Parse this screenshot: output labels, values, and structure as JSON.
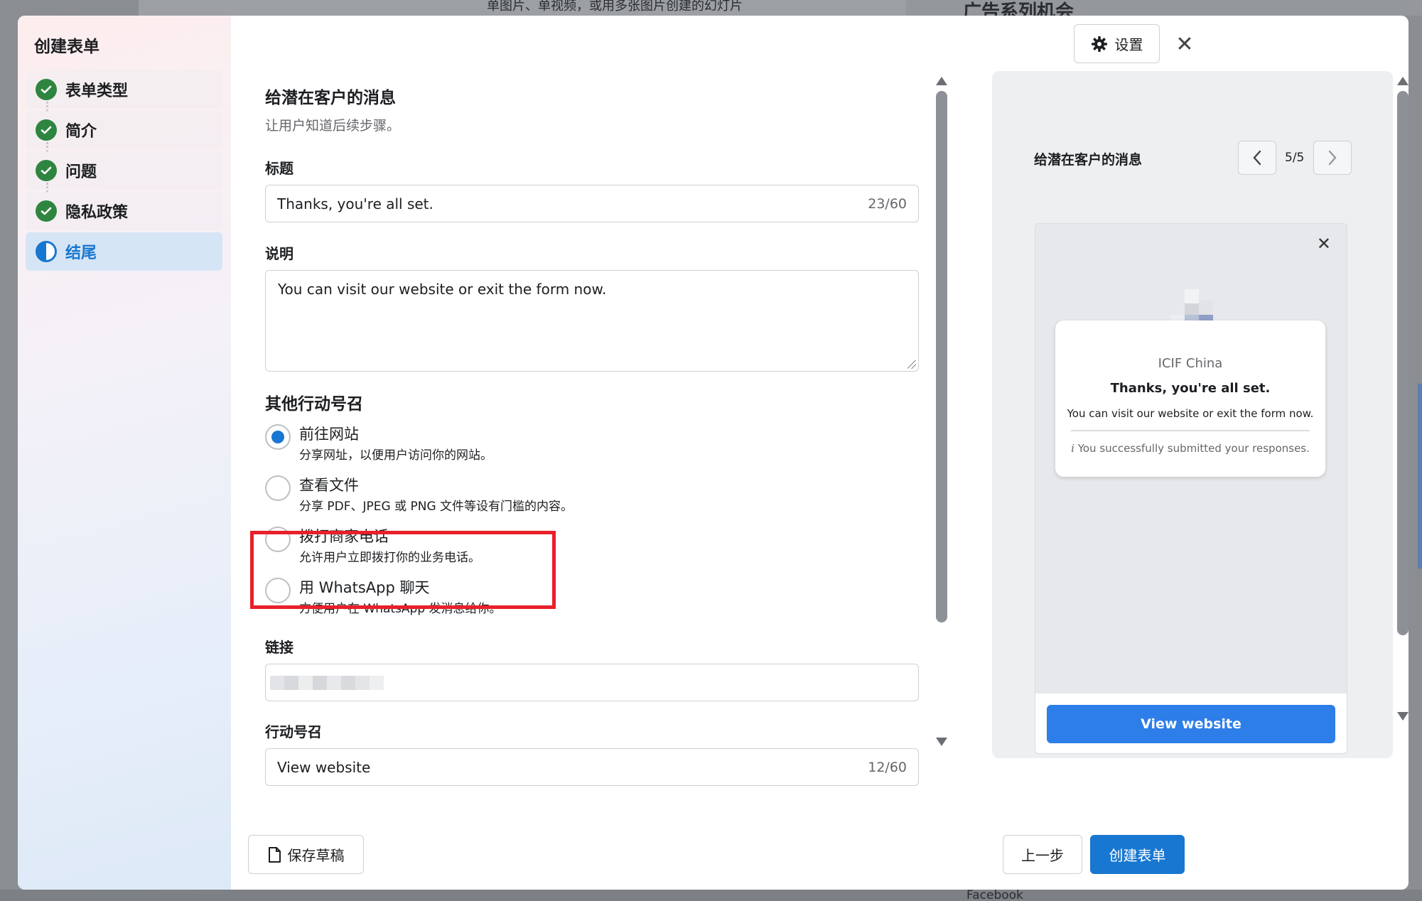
{
  "background": {
    "top_text": "单图片、单视频，或用多张图片创建的幻灯片",
    "top_right_text": "广告系列机会",
    "bottom_text": "Facebook"
  },
  "sidebar": {
    "title": "创建表单",
    "steps": [
      {
        "label": "表单类型",
        "status": "done"
      },
      {
        "label": "简介",
        "status": "done"
      },
      {
        "label": "问题",
        "status": "done"
      },
      {
        "label": "隐私政策",
        "status": "done"
      },
      {
        "label": "结尾",
        "status": "active"
      }
    ]
  },
  "header": {
    "settings_label": "设置"
  },
  "form": {
    "section_title": "给潜在客户的消息",
    "section_subtitle": "让用户知道后续步骤。",
    "headline": {
      "label": "标题",
      "value": "Thanks, you're all set.",
      "counter": "23/60"
    },
    "description": {
      "label": "说明",
      "value": "You can visit our website or exit the form now."
    },
    "cta_section_title": "其他行动号召",
    "cta_options": [
      {
        "title": "前往网站",
        "desc": "分享网址，以便用户访问你的网站。",
        "checked": true
      },
      {
        "title": "查看文件",
        "desc": "分享 PDF、JPEG 或 PNG 文件等设有门槛的内容。",
        "checked": false
      },
      {
        "title": "拨打商家电话",
        "desc": "允许用户立即拨打你的业务电话。",
        "checked": false
      },
      {
        "title": "用 WhatsApp 聊天",
        "desc": "方便用户在 WhatsApp 发消息给你。",
        "checked": false
      }
    ],
    "link": {
      "label": "链接"
    },
    "cta_button": {
      "label": "行动号召",
      "value": "View website",
      "counter": "12/60"
    }
  },
  "preview": {
    "title": "给潜在客户的消息",
    "pager": "5/5",
    "org_name": "ICIF China",
    "card_title": "Thanks, you're all set.",
    "card_desc": "You can visit our website or exit the form now.",
    "card_note_icon": "i",
    "card_note": "You successfully submitted your responses.",
    "button_label": "View website"
  },
  "footer": {
    "save_draft": "保存草稿",
    "prev": "上一步",
    "create": "创建表单"
  },
  "colors": {
    "accent": "#1877d0",
    "done_green": "#2e8540",
    "highlight_red": "#e8202a",
    "preview_button": "#2d7ee8"
  }
}
